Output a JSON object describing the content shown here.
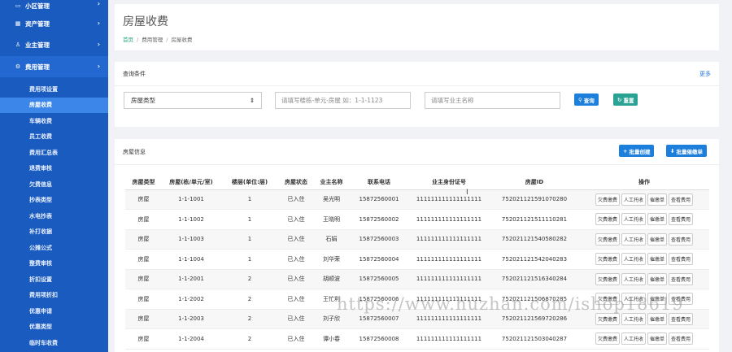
{
  "sidebar": {
    "groups": [
      {
        "label": "小区管理",
        "icon": "monitor-icon"
      },
      {
        "label": "资产管理",
        "icon": "grid-icon"
      },
      {
        "label": "业主管理",
        "icon": "user-icon"
      },
      {
        "label": "费用管理",
        "icon": "settings-icon"
      }
    ],
    "sub_items": [
      "费用项设置",
      "房屋收费",
      "车辆收费",
      "员工收费",
      "费用汇总表",
      "退费审核",
      "欠费信息",
      "抄表类型",
      "水电抄表",
      "补打收据",
      "公摊公式",
      "整费审核",
      "折扣设置",
      "费用项折扣",
      "优惠申请",
      "优惠类型",
      "临时车收费"
    ]
  },
  "header": {
    "title": "房屋收费",
    "crumbs": [
      "首页",
      "费用管理",
      "房屋收费"
    ]
  },
  "query": {
    "title": "查询条件",
    "more": "更多",
    "select_value": "房屋类型",
    "room_placeholder": "请填写楼栋-单元-房屋 如：1-1-1123",
    "owner_placeholder": "请填写业主名称",
    "search_label": "查询",
    "reset_label": "重置"
  },
  "table": {
    "title": "房屋信息",
    "batch_create": "批量创建",
    "batch_receipt": "批量催缴单",
    "columns": [
      "房屋类型",
      "房屋(栋/单元/室)",
      "楼层(单位:层)",
      "房屋状态",
      "业主名称",
      "联系电话",
      "业主身份证号",
      "房屋ID",
      "操作"
    ],
    "ops": [
      "欠费缴费",
      "人工托收",
      "催缴单",
      "查看费用"
    ],
    "rows": [
      [
        "房屋",
        "1-1-1001",
        "1",
        "已入住",
        "吴光明",
        "15872560001",
        "111111111111111111",
        "752021121591070280"
      ],
      [
        "房屋",
        "1-1-1002",
        "1",
        "已入住",
        "王晓明",
        "15872560002",
        "111111111111111111",
        "752021121511110281"
      ],
      [
        "房屋",
        "1-1-1003",
        "1",
        "已入住",
        "石娟",
        "15872560003",
        "111111111111111111",
        "752021121540580282"
      ],
      [
        "房屋",
        "1-1-1004",
        "1",
        "已入住",
        "刘华荣",
        "15872560004",
        "111111111111111111",
        "752021121542040283"
      ],
      [
        "房屋",
        "1-1-2001",
        "2",
        "已入住",
        "胡顺波",
        "15872560005",
        "111111111111111111",
        "752021121516340284"
      ],
      [
        "房屋",
        "1-1-2002",
        "2",
        "已入住",
        "王忙利",
        "15872560006",
        "111111111111111111",
        "752021121506870285"
      ],
      [
        "房屋",
        "1-1-2003",
        "2",
        "已入住",
        "刘子欣",
        "15872560007",
        "111111111111111111",
        "752021121569720286"
      ],
      [
        "房屋",
        "1-1-2004",
        "2",
        "已入住",
        "谭小春",
        "15872560008",
        "111111111111111111",
        "752021121503040287"
      ]
    ]
  },
  "watermark": "https://www.huzhan.com/ishop18619"
}
